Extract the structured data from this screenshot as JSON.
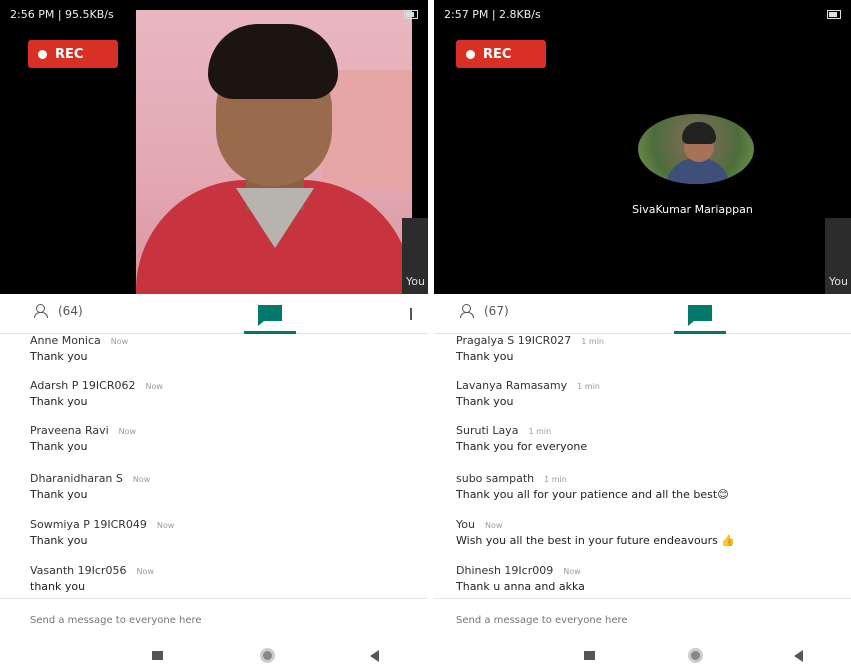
{
  "left": {
    "status_time": "2:56 PM | 95.5KB/s",
    "rec_label": "REC",
    "side_tab_label": "You",
    "people_count": "(64)",
    "messages": [
      {
        "sender": "Anne Monica",
        "time": "Now",
        "text": "Thank you"
      },
      {
        "sender": "Adarsh P 19ICR062",
        "time": "Now",
        "text": "Thank you"
      },
      {
        "sender": "Praveena Ravi",
        "time": "Now",
        "text": "Thank you"
      },
      {
        "sender": "Dharanidharan S",
        "time": "Now",
        "text": "Thank you"
      },
      {
        "sender": "Sowmiya P 19ICR049",
        "time": "Now",
        "text": "Thank you"
      },
      {
        "sender": "Vasanth 19Icr056",
        "time": "Now",
        "text": "thank you"
      }
    ],
    "composer_placeholder": "Send a message to everyone here"
  },
  "right": {
    "status_time": "2:57 PM | 2.8KB/s",
    "rec_label": "REC",
    "side_tab_label": "You",
    "avatar_name": "SivaKumar Mariappan",
    "people_count": "(67)",
    "messages": [
      {
        "sender": "Pragalya S 19ICR027",
        "time": "1 min",
        "text": "Thank you"
      },
      {
        "sender": "Lavanya Ramasamy",
        "time": "1 min",
        "text": "Thank you"
      },
      {
        "sender": "Suruti Laya",
        "time": "1 min",
        "text": "Thank you for everyone"
      },
      {
        "sender": "subo sampath",
        "time": "1 min",
        "text": "Thank you all for your patience and all the best😊"
      },
      {
        "sender": "You",
        "time": "Now",
        "text": "Wish you all the best in your future endeavours 👍"
      },
      {
        "sender": "Dhinesh 19Icr009",
        "time": "Now",
        "text": "Thank u anna and akka"
      }
    ],
    "composer_placeholder": "Send a message to everyone here"
  },
  "colors": {
    "rec": "#d93025",
    "accent": "#00796b"
  },
  "icons": [
    "people-icon",
    "chat-icon",
    "nav-square-icon",
    "nav-home-icon",
    "nav-back-icon"
  ]
}
